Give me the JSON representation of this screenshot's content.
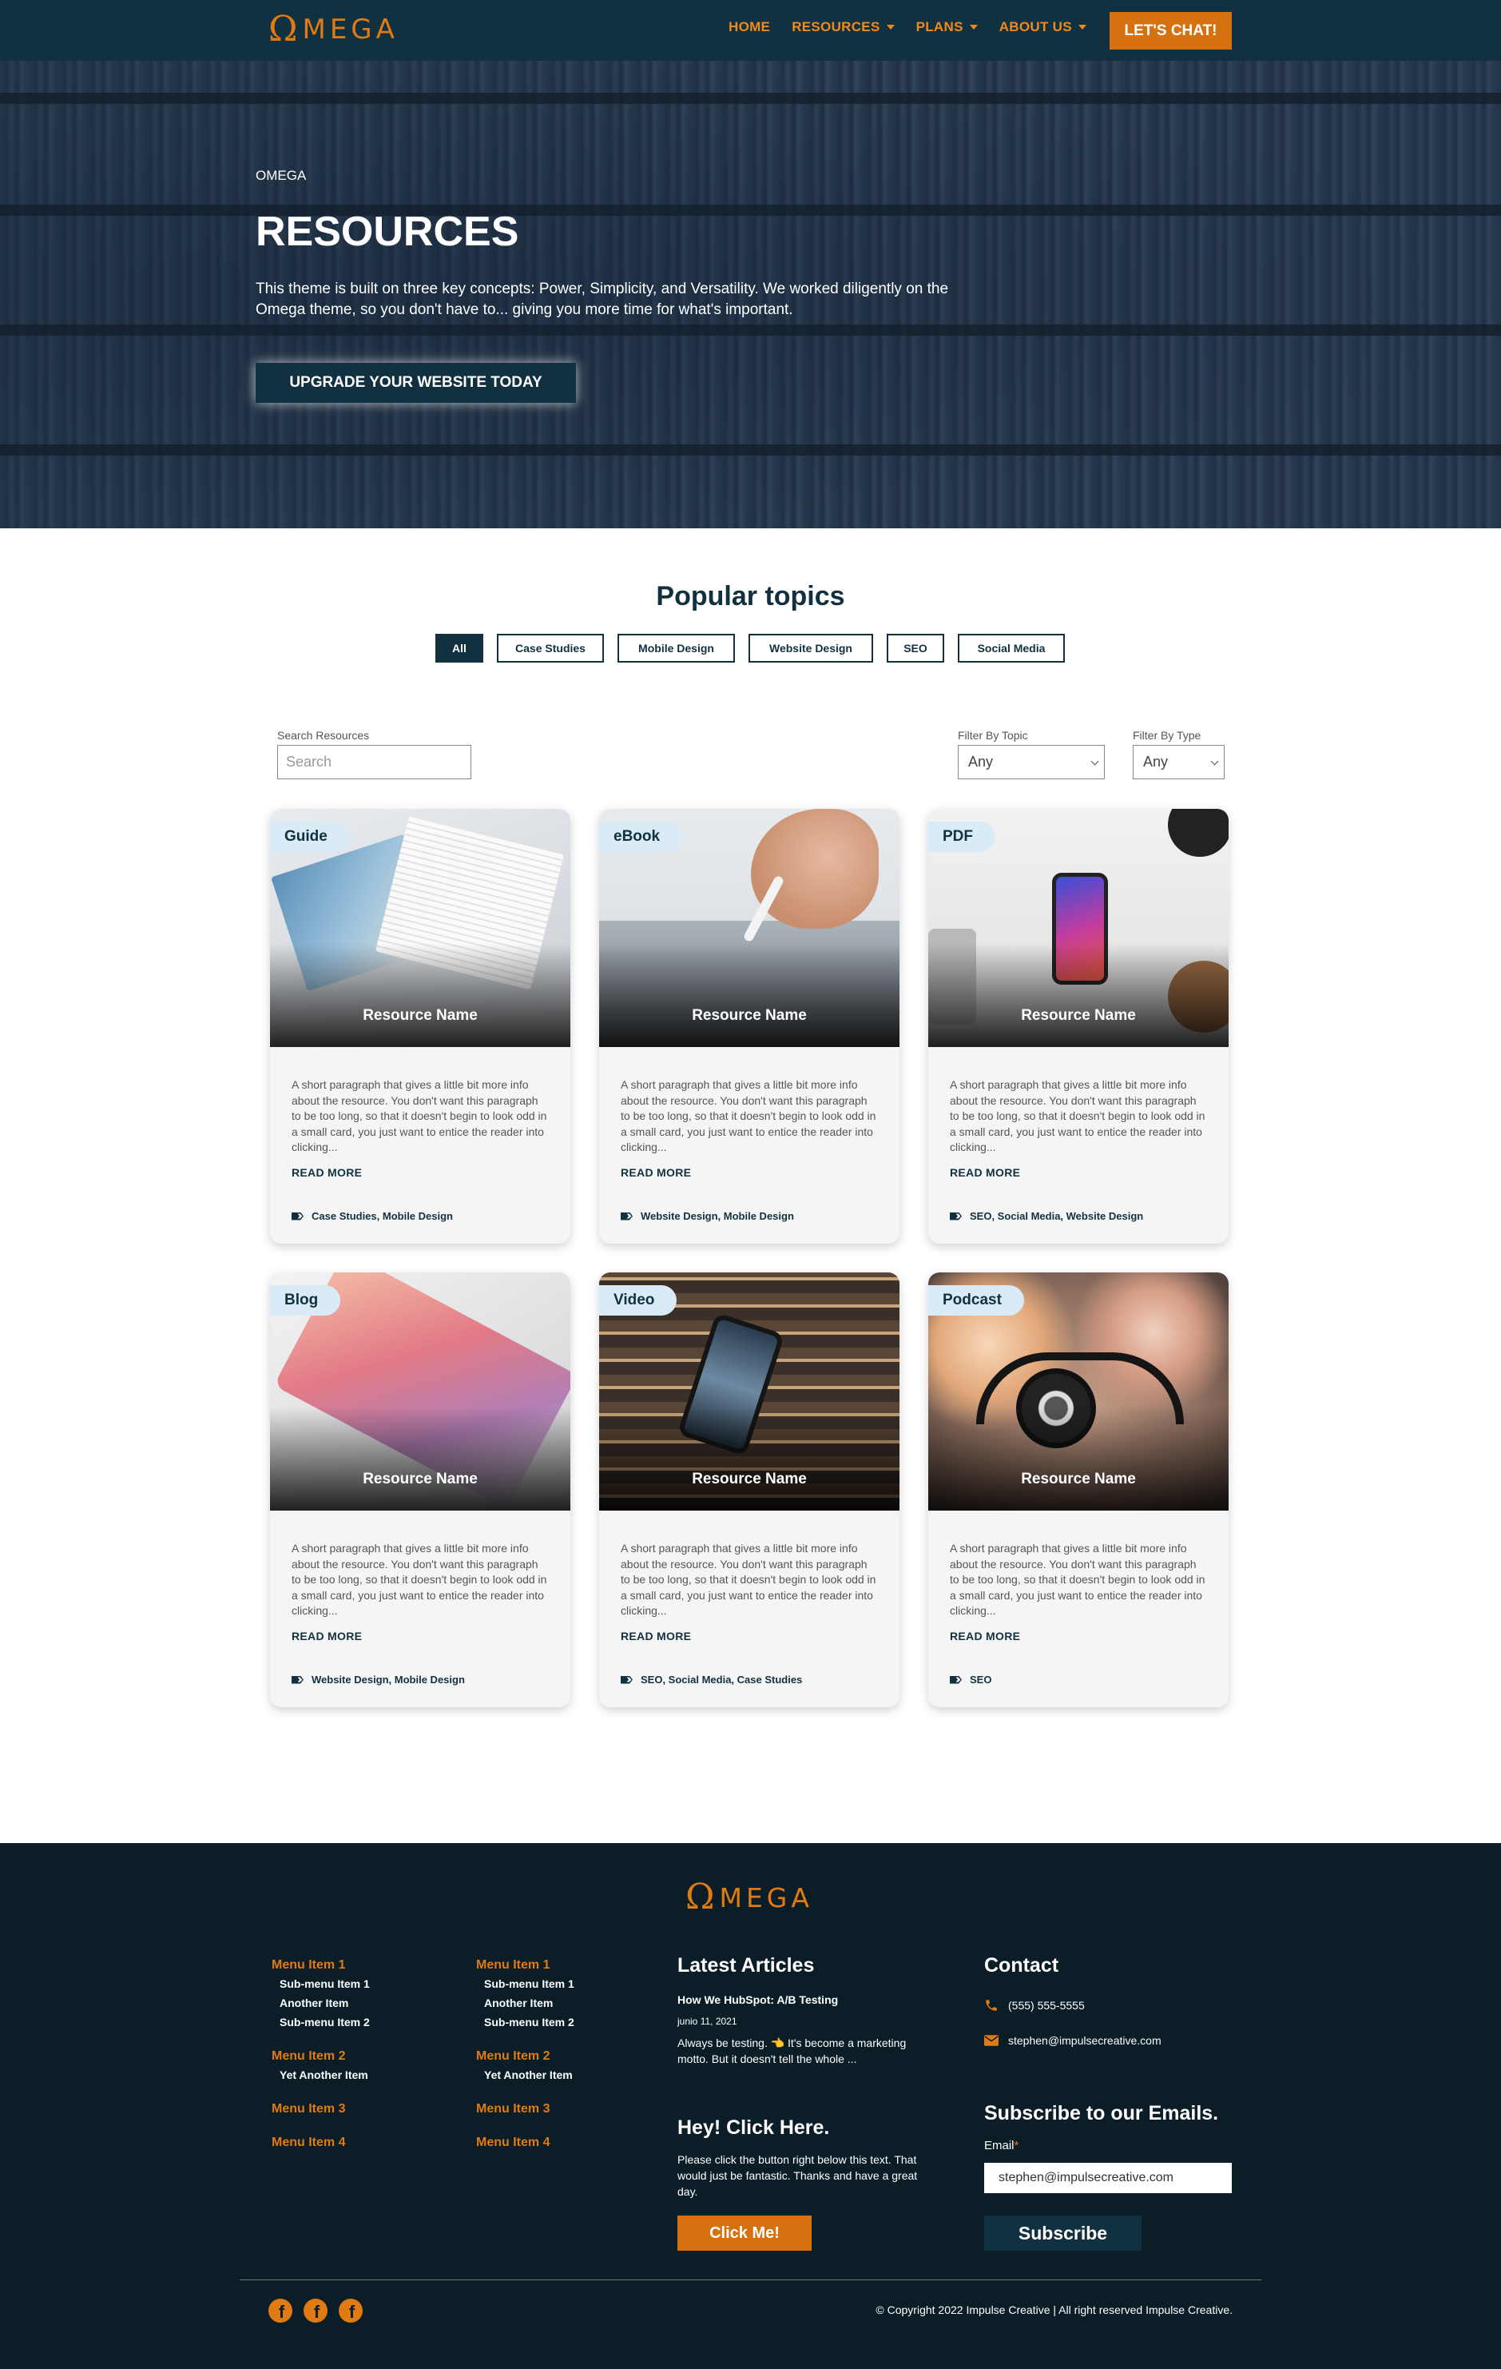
{
  "nav": {
    "logo_symbol": "Ω",
    "logo_word": "MEGA",
    "items": [
      {
        "label": "HOME",
        "dropdown": false
      },
      {
        "label": "RESOURCES",
        "dropdown": true
      },
      {
        "label": "PLANS",
        "dropdown": true
      },
      {
        "label": "ABOUT US",
        "dropdown": true
      }
    ],
    "cta": "LET'S CHAT!"
  },
  "hero": {
    "kicker": "OMEGA",
    "title": "RESOURCES",
    "description": "This theme is built on three key concepts: Power, Simplicity, and Versatility. We worked diligently on the Omega theme, so you don't have to... giving you more time for what's important.",
    "button": "UPGRADE YOUR WEBSITE TODAY"
  },
  "topics": {
    "title": "Popular topics",
    "tags": [
      "All",
      "Case Studies",
      "Mobile Design",
      "Website Design",
      "SEO",
      "Social Media"
    ],
    "active": "All"
  },
  "filters": {
    "search_label": "Search Resources",
    "search_placeholder": "Search",
    "topic_label": "Filter By Topic",
    "topic_value": "Any",
    "type_label": "Filter By Type",
    "type_value": "Any"
  },
  "cards": [
    {
      "type": "Guide",
      "name": "Resource Name",
      "text": "A short paragraph that gives a little bit more info about the resource. You don't want this paragraph to be too long, so that it doesn't begin to look odd in a small card, you just want to entice the reader into clicking...",
      "more": "READ MORE",
      "tags": "Case Studies, Mobile Design"
    },
    {
      "type": "eBook",
      "name": "Resource Name",
      "text": "A short paragraph that gives a little bit more info about the resource. You don't want this paragraph to be too long, so that it doesn't begin to look odd in a small card, you just want to entice the reader into clicking...",
      "more": "READ MORE",
      "tags": "Website Design, Mobile Design"
    },
    {
      "type": "PDF",
      "name": "Resource Name",
      "text": "A short paragraph that gives a little bit more info about the resource. You don't want this paragraph to be too long, so that it doesn't begin to look odd in a small card, you just want to entice the reader into clicking...",
      "more": "READ MORE",
      "tags": "SEO, Social Media, Website Design"
    },
    {
      "type": "Blog",
      "name": "Resource Name",
      "text": "A short paragraph that gives a little bit more info about the resource. You don't want this paragraph to be too long, so that it doesn't begin to look odd in a small card, you just want to entice the reader into clicking...",
      "more": "READ MORE",
      "tags": "Website Design, Mobile Design"
    },
    {
      "type": "Video",
      "name": "Resource Name",
      "text": "A short paragraph that gives a little bit more info about the resource. You don't want this paragraph to be too long, so that it doesn't begin to look odd in a small card, you just want to entice the reader into clicking...",
      "more": "READ MORE",
      "tags": "SEO, Social Media, Case Studies"
    },
    {
      "type": "Podcast",
      "name": "Resource Name",
      "text": "A short paragraph that gives a little bit more info about the resource. You don't want this paragraph to be too long, so that it doesn't begin to look odd in a small card, you just want to entice the reader into clicking...",
      "more": "READ MORE",
      "tags": "SEO"
    }
  ],
  "footer": {
    "logo_symbol": "Ω",
    "logo_word": "MEGA",
    "menus": [
      {
        "m1": "Menu Item 1",
        "s1": "Sub-menu Item 1",
        "s2": "Another Item",
        "s3": "Sub-menu Item 2",
        "m2": "Menu Item 2",
        "s4": "Yet Another Item",
        "m3": "Menu Item 3",
        "m4": "Menu Item 4"
      },
      {
        "m1": "Menu Item 1",
        "s1": "Sub-menu Item 1",
        "s2": "Another Item",
        "s3": "Sub-menu Item 2",
        "m2": "Menu Item 2",
        "s4": "Yet Another Item",
        "m3": "Menu Item 3",
        "m4": "Menu Item 4"
      }
    ],
    "articles": {
      "title": "Latest Articles",
      "post_title": "How We HubSpot: A/B Testing",
      "post_date": "junio 11, 2021",
      "post_excerpt": "Always be testing. 👈 It's become a marketing motto. But it doesn't tell the whole ..."
    },
    "click": {
      "title": "Hey! Click Here.",
      "text": "Please click the button right below this text. That would just be fantastic. Thanks and have a great day.",
      "button": "Click Me!"
    },
    "contact": {
      "title": "Contact",
      "phone": "(555) 555-5555",
      "email": "stephen@impulsecreative.com"
    },
    "subscribe": {
      "title": "Subscribe to our Emails.",
      "email_label": "Email",
      "email_value": "stephen@impulsecreative.com",
      "button": "Subscribe"
    },
    "social": [
      "facebook-icon",
      "facebook-icon",
      "facebook-icon"
    ],
    "copyright": "© Copyright 2022 Impulse Creative | All right reserved Impulse Creative."
  },
  "colors": {
    "navy": "#123140",
    "orange": "#d5720f",
    "footer_bg": "#0b1e27",
    "badge": "#d8ebf6"
  }
}
